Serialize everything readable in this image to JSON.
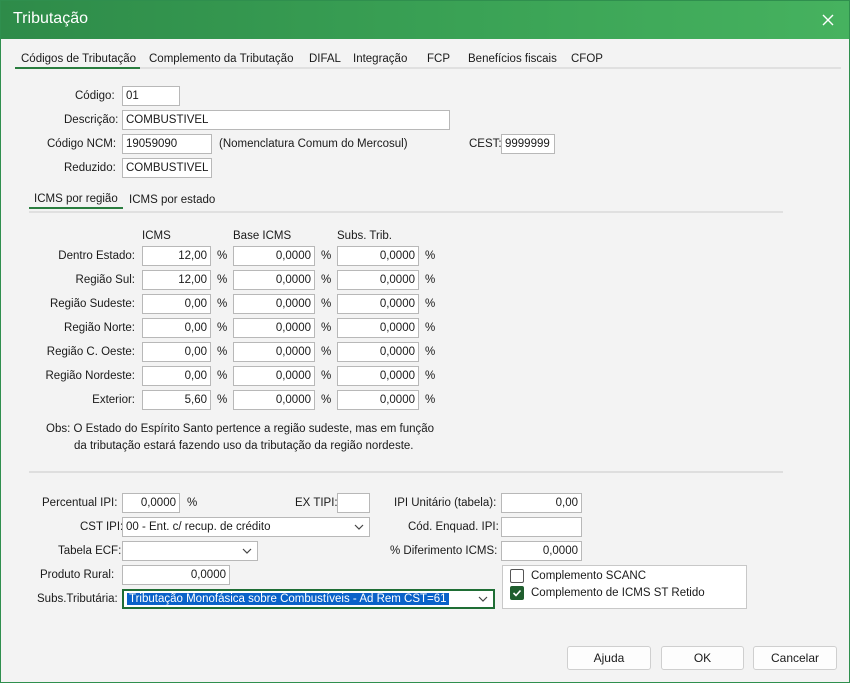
{
  "window": {
    "title": "Tributação"
  },
  "tabs": [
    "Códigos de Tributação",
    "Complemento da Tributação",
    "DIFAL",
    "Integração",
    "FCP",
    "Benefícios fiscais",
    "CFOP"
  ],
  "form": {
    "codigo_label": "Código:",
    "codigo": "01",
    "descricao_label": "Descrição:",
    "descricao": "COMBUSTIVEL",
    "ncm_label": "Código NCM:",
    "ncm": "19059090",
    "ncm_desc": "(Nomenclatura Comum do Mercosul)",
    "cest_label": "CEST:",
    "cest": "9999999",
    "reduzido_label": "Reduzido:",
    "reduzido": "COMBUSTIVEL"
  },
  "subtabs": [
    "ICMS por região",
    "ICMS por estado"
  ],
  "icms": {
    "headers": [
      "ICMS",
      "Base ICMS",
      "Subs. Trib."
    ],
    "pct": "%",
    "rows": [
      {
        "label": "Dentro Estado:",
        "icms": "12,00",
        "base": "0,0000",
        "subs": "0,0000"
      },
      {
        "label": "Região Sul:",
        "icms": "12,00",
        "base": "0,0000",
        "subs": "0,0000"
      },
      {
        "label": "Região Sudeste:",
        "icms": "0,00",
        "base": "0,0000",
        "subs": "0,0000"
      },
      {
        "label": "Região Norte:",
        "icms": "0,00",
        "base": "0,0000",
        "subs": "0,0000"
      },
      {
        "label": "Região C. Oeste:",
        "icms": "0,00",
        "base": "0,0000",
        "subs": "0,0000"
      },
      {
        "label": "Região Nordeste:",
        "icms": "0,00",
        "base": "0,0000",
        "subs": "0,0000"
      },
      {
        "label": "Exterior:",
        "icms": "5,60",
        "base": "0,0000",
        "subs": "0,0000"
      }
    ],
    "obs_line1": "Obs: O Estado do Espírito Santo pertence a região sudeste, mas em função",
    "obs_line2": "da tributação estará fazendo uso da tributação da região nordeste."
  },
  "bottom": {
    "ipi_label": "Percentual IPI:",
    "ipi": "0,0000",
    "ipi_pct": "%",
    "ex_tipi_label": "EX TIPI:",
    "ex_tipi": "",
    "ipi_unit_label": "IPI Unitário (tabela):",
    "ipi_unit": "0,00",
    "cst_ipi_label": "CST IPI:",
    "cst_ipi": "00 - Ent. c/ recup. de crédito",
    "cod_enq_label": "Cód. Enquad. IPI:",
    "cod_enq": "",
    "tabela_ecf_label": "Tabela ECF:",
    "tabela_ecf": "",
    "diferimento_label": "% Diferimento ICMS:",
    "diferimento": "0,0000",
    "produto_rural_label": "Produto Rural:",
    "produto_rural": "0,0000",
    "subs_trib_label": "Subs.Tributária:",
    "subs_trib": "Tributação Monofásica sobre Combustíveis - Ad Rem CST=61",
    "scanc_label": "Complemento SCANC",
    "scanc_checked": false,
    "icms_st_label": "Complemento de ICMS ST Retido",
    "icms_st_checked": true
  },
  "buttons": {
    "help": "Ajuda",
    "ok": "OK",
    "cancel": "Cancelar"
  },
  "colors": {
    "titlebar": "#3aa255",
    "accent": "#1f5e2e"
  }
}
